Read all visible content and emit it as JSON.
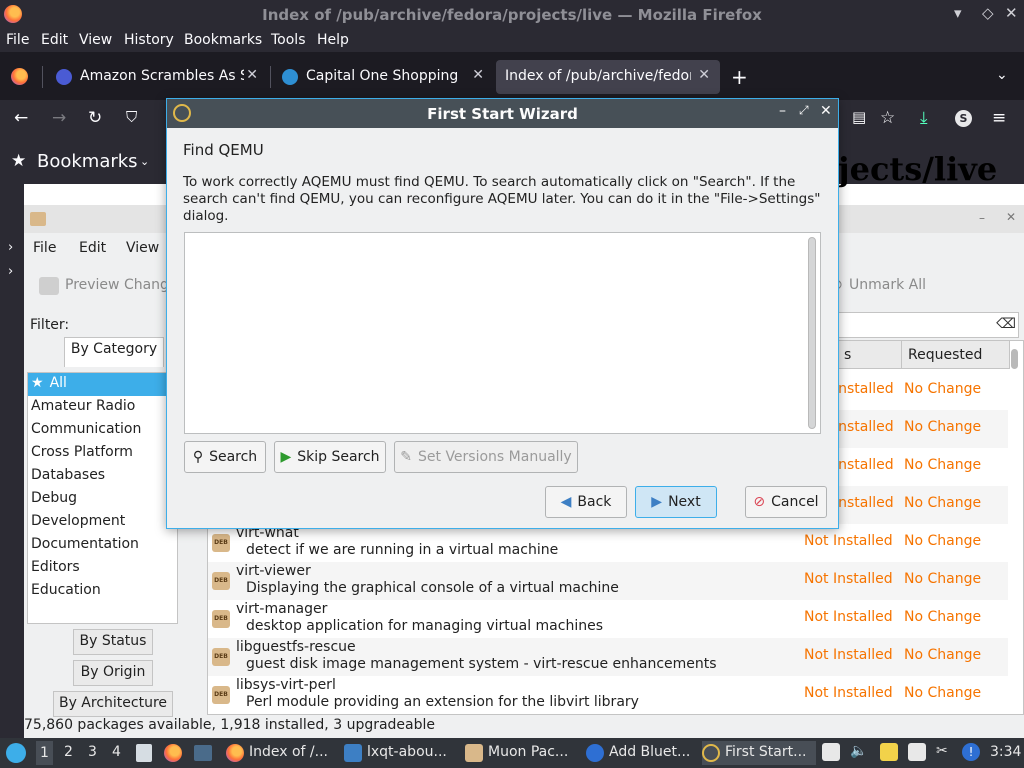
{
  "firefox": {
    "window_title": "Index of /pub/archive/fedora/projects/live — Mozilla Firefox",
    "menu": [
      "File",
      "Edit",
      "View",
      "History",
      "Bookmarks",
      "Tools",
      "Help"
    ],
    "tabs": [
      {
        "label": "Amazon Scrambles As Sh"
      },
      {
        "label": "Capital One Shopping"
      },
      {
        "label": "Index of /pub/archive/fedora"
      }
    ],
    "bookmarks_label": "Bookmarks",
    "page_heading": "jects/live"
  },
  "muon": {
    "menu": [
      "File",
      "Edit",
      "View"
    ],
    "toolbar": {
      "preview_changes": "Preview Chang",
      "unmark_all": "Unmark All"
    },
    "filter_label": "Filter:",
    "filter_tabs": {
      "by_category": "By Category",
      "by_status": "By Status",
      "by_origin": "By Origin",
      "by_architecture": "By Architecture"
    },
    "categories": [
      "All",
      "Amateur Radio",
      "Communication",
      "Cross Platform",
      "Databases",
      "Debug",
      "Development",
      "Documentation",
      "Editors",
      "Education"
    ],
    "columns": {
      "status": "s",
      "requested": "Requested"
    },
    "packages": [
      {
        "name": "",
        "desc": "",
        "status": "Installed",
        "requested": "No Change"
      },
      {
        "name": "",
        "desc": "",
        "status": "Installed",
        "requested": "No Change"
      },
      {
        "name": "",
        "desc": "",
        "status": "Installed",
        "requested": "No Change"
      },
      {
        "name": "",
        "desc": "",
        "status": "Installed",
        "requested": "No Change"
      },
      {
        "name": "virt-what",
        "desc": "detect if we are running in a virtual machine",
        "status": "Not Installed",
        "requested": "No Change"
      },
      {
        "name": "virt-viewer",
        "desc": "Displaying the graphical console of a virtual machine",
        "status": "Not Installed",
        "requested": "No Change"
      },
      {
        "name": "virt-manager",
        "desc": "desktop application for managing virtual machines",
        "status": "Not Installed",
        "requested": "No Change"
      },
      {
        "name": "libguestfs-rescue",
        "desc": "guest disk image management system - virt-rescue enhancements",
        "status": "Not Installed",
        "requested": "No Change"
      },
      {
        "name": "libsys-virt-perl",
        "desc": "Perl module providing an extension for the libvirt library",
        "status": "Not Installed",
        "requested": "No Change"
      }
    ],
    "status_bar": "75,860 packages available, 1,918 installed, 3 upgradeable"
  },
  "wizard": {
    "title": "First Start Wizard",
    "heading": "Find QEMU",
    "description": "To work correctly AQEMU must find QEMU. To search automatically click on \"Search\". If the search can't find QEMU, you can reconfigure AQEMU later. You can do it in the \"File->Settings\" dialog.",
    "output_text": "",
    "buttons": {
      "search": "Search",
      "skip_search": "Skip Search",
      "set_versions_manually": "Set Versions Manually",
      "back": "Back",
      "next": "Next",
      "cancel": "Cancel"
    }
  },
  "taskbar": {
    "workspaces": [
      "1",
      "2",
      "3",
      "4"
    ],
    "tasks": [
      {
        "label": "Index of /..."
      },
      {
        "label": "lxqt-abou..."
      },
      {
        "label": "Muon Pac..."
      },
      {
        "label": "Add Bluet..."
      },
      {
        "label": "First Start..."
      }
    ],
    "clock": "3:34"
  },
  "colors": {
    "accent": "#3daee9",
    "status_orange": "#f67400",
    "firefox_dark": "#2b2a33",
    "titlebar_dark": "#475057"
  }
}
